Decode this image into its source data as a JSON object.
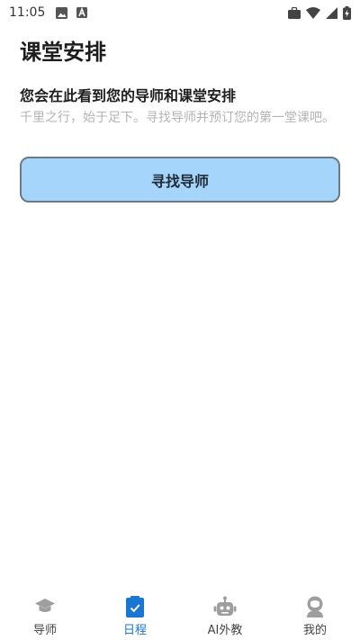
{
  "status_bar": {
    "time": "11:05"
  },
  "main": {
    "title": "课堂安排",
    "empty_heading": "您会在此看到您的导师和课堂安排",
    "empty_description": "千里之行，始于足下。寻找导师并预订您的第一堂课吧。",
    "find_button_label": "寻找导师"
  },
  "tabs": [
    {
      "label": "导师",
      "icon": "graduation-cap-icon",
      "active": false
    },
    {
      "label": "日程",
      "icon": "clipboard-check-icon",
      "active": true
    },
    {
      "label": "AI外教",
      "icon": "robot-icon",
      "active": false
    },
    {
      "label": "我的",
      "icon": "profile-icon",
      "active": false
    }
  ],
  "colors": {
    "accent": "#1976d2",
    "button_bg": "#a6d5fb",
    "icon_gray": "#9e9e9e"
  }
}
